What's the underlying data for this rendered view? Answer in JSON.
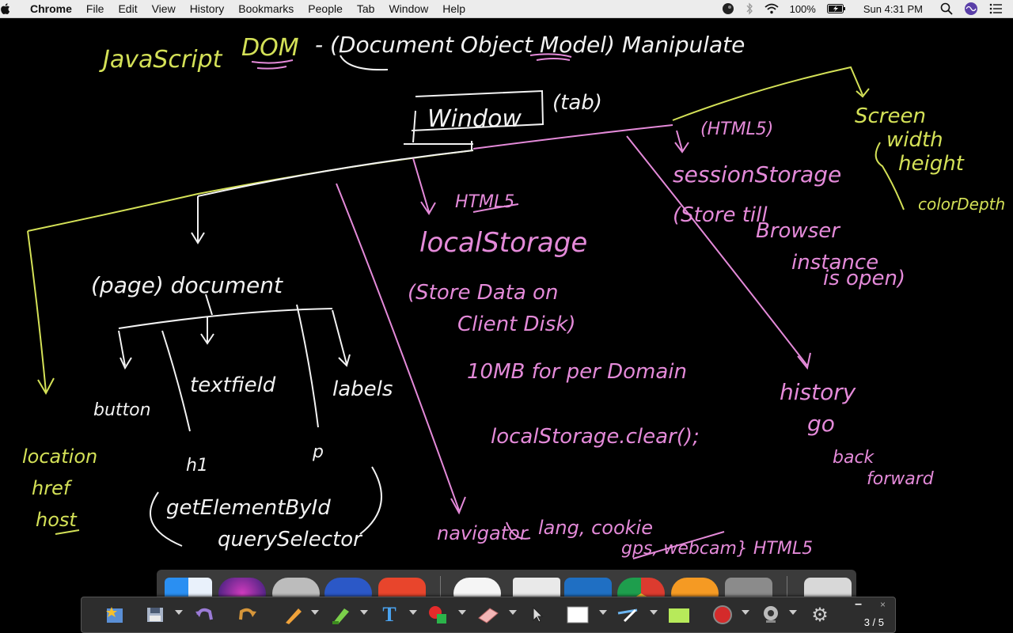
{
  "menubar": {
    "apple": "",
    "app_name": "Chrome",
    "menus": [
      "File",
      "Edit",
      "View",
      "History",
      "Bookmarks",
      "People",
      "Tab",
      "Window",
      "Help"
    ],
    "battery": "100%",
    "clock": "Sun 4:31 PM"
  },
  "notes": {
    "title_js": "JavaScript",
    "title_dom": "DOM",
    "title_rest": "- (Document Object Model) Manipulate",
    "window": "Window",
    "tab": "(tab)",
    "page_doc": "(page) document",
    "button": "button",
    "textfield": "textfield",
    "label": "labels",
    "h1": "h1",
    "p": "p",
    "getbyid": "getElementById",
    "queryselector": "querySelector",
    "location": "location",
    "href": "href",
    "host": "host",
    "html5_local": "HTML5",
    "localstorage": "localStorage",
    "store_disk_1": "(Store Data on",
    "store_disk_2": "Client Disk)",
    "tenmb": "10MB for per Domain",
    "clear": "localStorage.clear();",
    "navigator": "navigator",
    "nav_detail": "lang, cookie",
    "nav_detail2": "gps, webcam} HTML5",
    "html5_session": "(HTML5)",
    "sessionstorage": "sessionStorage",
    "store_till": "(Store till",
    "browser": "Browser",
    "instance": "instance",
    "isopen": "is open)",
    "history": "history",
    "go": "go",
    "back": "back",
    "forward": "forward",
    "screen": "Screen",
    "width": "width",
    "height": "height",
    "colordepth": "colorDepth"
  },
  "toolbar": {
    "page_indicator": "3 / 5",
    "minimize": "–",
    "close": "×"
  },
  "colors": {
    "yellow": "#d4e157",
    "white": "#f2f2f2",
    "pink": "#e48ad9",
    "menubar_bg": "#ececec"
  }
}
